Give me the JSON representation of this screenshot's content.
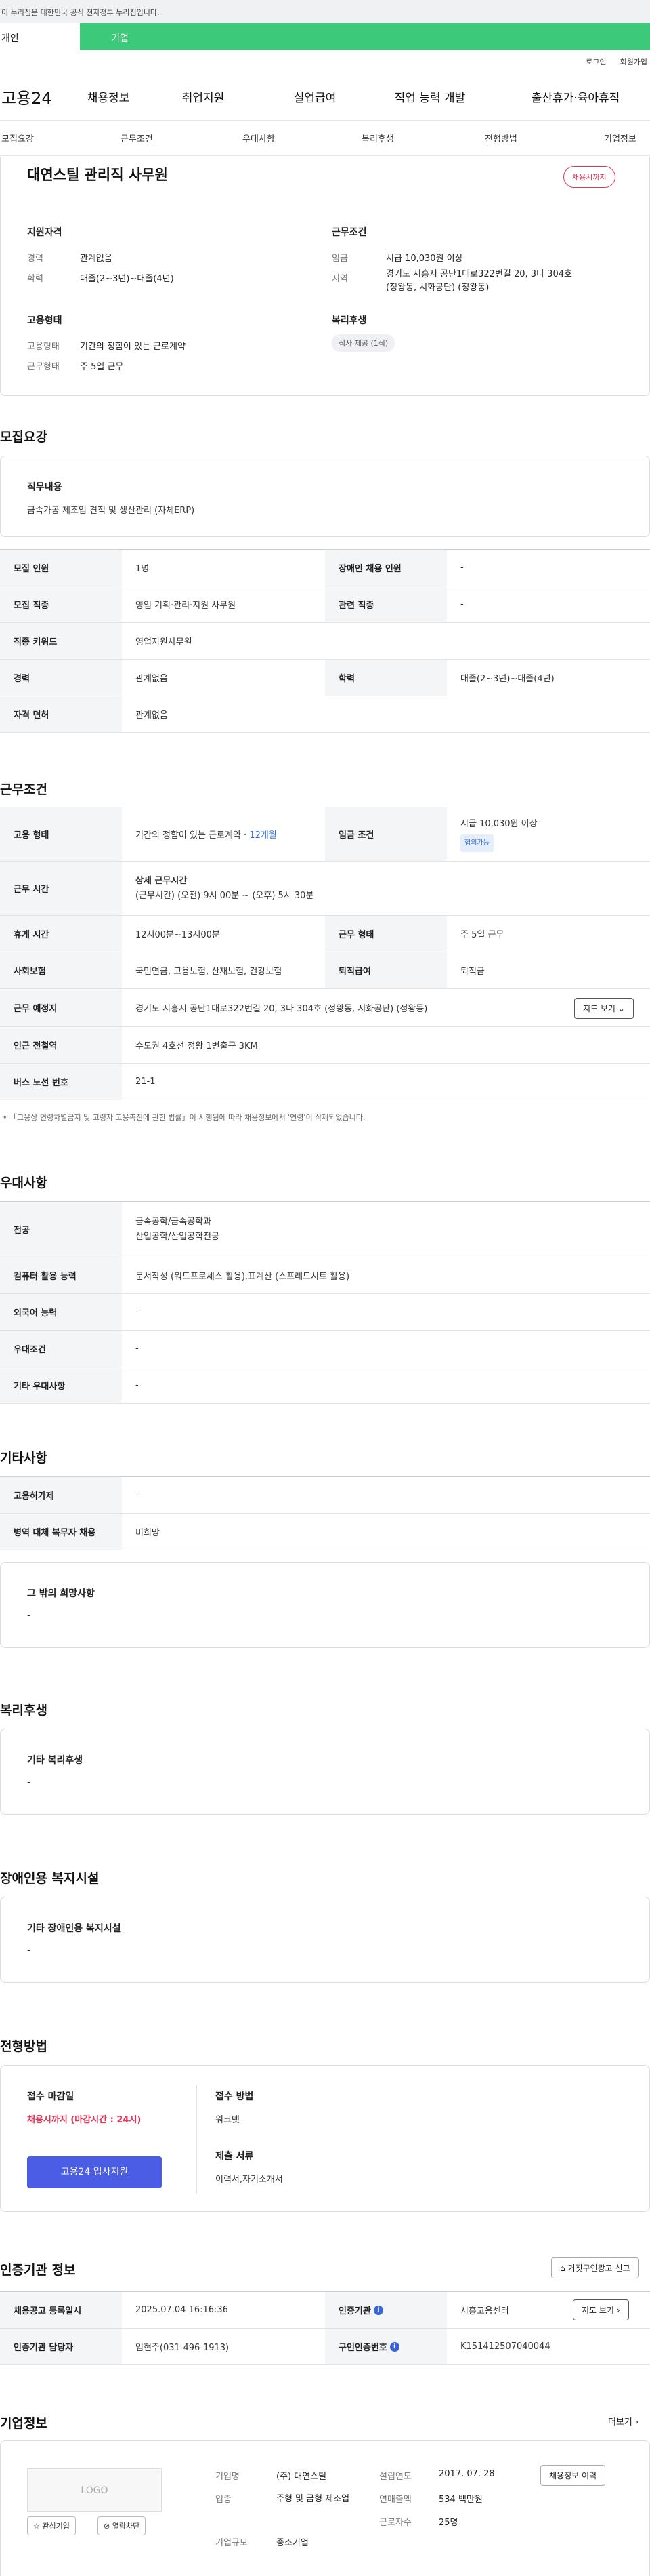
{
  "gov_banner": "이 누리집은 대한민국 공식 전자정부 누리집입니다.",
  "user_tabs": [
    "개인",
    "기업"
  ],
  "util": {
    "login": "로그인",
    "signup": "회원가입"
  },
  "gnb": {
    "logo": "고용24",
    "items": [
      "채용정보",
      "취업지원",
      "실업급여",
      "직업 능력 개발",
      "출산휴가·육아휴직"
    ]
  },
  "subnav": [
    "모집요강",
    "근무조건",
    "우대사항",
    "복리후생",
    "전형방법",
    "기업정보"
  ],
  "summary": {
    "title": "대연스틸 관리직 사무원",
    "badge": "채용시까지",
    "qual": {
      "heading": "지원자격",
      "career_label": "경력",
      "career": "관계없음",
      "edu_label": "학력",
      "edu": "대졸(2~3년)~대졸(4년)"
    },
    "cond": {
      "heading": "근무조건",
      "wage_label": "임금",
      "wage": "시급 10,030원 이상",
      "area_label": "지역",
      "area": "경기도 시흥시 공단1대로322번길 20, 3다 304호 (정왕동, 시화공단) (정왕동)"
    },
    "emp": {
      "heading": "고용형태",
      "type_label": "고용형태",
      "type": "기간의 정함이 있는 근로계약",
      "work_label": "근무형태",
      "work": "주 5일 근무"
    },
    "welfare": {
      "heading": "복리후생",
      "chip": "식사 제공 (1식)"
    }
  },
  "recruit": {
    "title": "모집요강",
    "duty_heading": "직무내용",
    "duty": "금속가공 제조업 견적 및 생산관리 (자체ERP)",
    "rows": [
      {
        "l1": "모집 인원",
        "v1": "1명",
        "l2": "장애인 채용 인원",
        "v2": "-"
      },
      {
        "l1": "모집 직종",
        "v1": "영업 기획·관리·지원 사무원",
        "l2": "관련 직종",
        "v2": "-"
      },
      {
        "l1": "직종 키워드",
        "v1": "영업지원사무원"
      },
      {
        "l1": "경력",
        "v1": "관계없음",
        "l2": "학력",
        "v2": "대졸(2~3년)~대졸(4년)"
      },
      {
        "l1": "자격 면허",
        "v1": "관계없음"
      }
    ]
  },
  "work": {
    "title": "근무조건",
    "emp_label": "고용 형태",
    "emp_value": "기간의 정함이 있는 근로계약 · ",
    "emp_months": "12개월",
    "wage_label": "임금 조건",
    "wage_value": "시급 10,030원 이상",
    "wage_badge": "협의가능",
    "time_label": "근무 시간",
    "time_heading": "상세 근무시간",
    "time_value": "(근무시간) (오전) 9시 00분 ~ (오후) 5시 30분",
    "rest_label": "휴게 시간",
    "rest_value": "12시00분~13시00분",
    "form_label": "근무 형태",
    "form_value": "주 5일 근무",
    "ins_label": "사회보험",
    "ins_value": "국민연금, 고용보험, 산재보험, 건강보험",
    "retire_label": "퇴직급여",
    "retire_value": "퇴직금",
    "loc_label": "근무 예정지",
    "loc_value": "경기도 시흥시 공단1대로322번길 20, 3다 304호 (정왕동, 시화공단) (정왕동)",
    "map_btn": "지도 보기",
    "subway_label": "인근 전철역",
    "subway_value": "수도권 4호선 정왕 1번출구 3KM",
    "bus_label": "버스 노선 번호",
    "bus_value": "21-1",
    "note": "「고용상 연령차별금지 및 고령자 고용촉진에 관한 법률」이 시행됨에 따라 채용정보에서 '연령'이 삭제되었습니다."
  },
  "pref": {
    "title": "우대사항",
    "rows": [
      {
        "l": "전공",
        "v": [
          "금속공학/금속공학과",
          "산업공학/산업공학전공"
        ]
      },
      {
        "l": "컴퓨터 활용 능력",
        "v": [
          "문서작성 (워드프로세스 활용),표계산 (스프레드시트 활용)"
        ]
      },
      {
        "l": "외국어 능력",
        "v": [
          "-"
        ]
      },
      {
        "l": "우대조건",
        "v": [
          "-"
        ]
      },
      {
        "l": "기타 우대사항",
        "v": [
          "-"
        ]
      }
    ]
  },
  "etc": {
    "title": "기타사항",
    "rows": [
      {
        "l": "고용허가제",
        "v": "-"
      },
      {
        "l": "병역 대체 복무자 채용",
        "v": "비희망"
      }
    ],
    "extra_heading": "그 밖의 희망사항",
    "extra": "-"
  },
  "welfare": {
    "title": "복리후생",
    "heading": "기타 복리후생",
    "value": "-"
  },
  "disabled": {
    "title": "장애인용 복지시설",
    "heading": "기타 장애인용 복지시설",
    "value": "-"
  },
  "select": {
    "title": "전형방법",
    "deadline_label": "접수 마감일",
    "deadline_value": "채용시까지 (마감시간 : 24시)",
    "method_label": "접수 방법",
    "method_value": "워크넷",
    "docs_label": "제출 서류",
    "docs_value": "이력서,자기소개서",
    "apply_btn": "고용24 입사지원"
  },
  "agency": {
    "title": "인증기관 정보",
    "report_btn": "거짓구인광고 신고",
    "rows": [
      {
        "l1": "채용공고 등록일시",
        "v1": "2025.07.04 16:16:36",
        "l2": "인증기관",
        "v2": "시흥고용센터",
        "btn": "지도 보기"
      },
      {
        "l1": "인증기관 담당자",
        "v1": "임현주(031-496-1913)",
        "l2": "구인인증번호",
        "v2": "K151412507040044"
      }
    ]
  },
  "company": {
    "title": "기업정보",
    "more": "더보기",
    "logo": "LOGO",
    "fav_btn": "관심기업",
    "block_btn": "열람차단",
    "name_label": "기업명",
    "name": "(주) 대연스틸",
    "industry_label": "업종",
    "industry": "주형 및 금형 제조업",
    "size_label": "기업규모",
    "size": "중소기업",
    "founded_label": "설립연도",
    "founded": "2017. 07. 28",
    "revenue_label": "연매출액",
    "revenue": "534 백만원",
    "staff_label": "근로자수",
    "staff": "25명",
    "history_btn": "채용정보 이력"
  }
}
